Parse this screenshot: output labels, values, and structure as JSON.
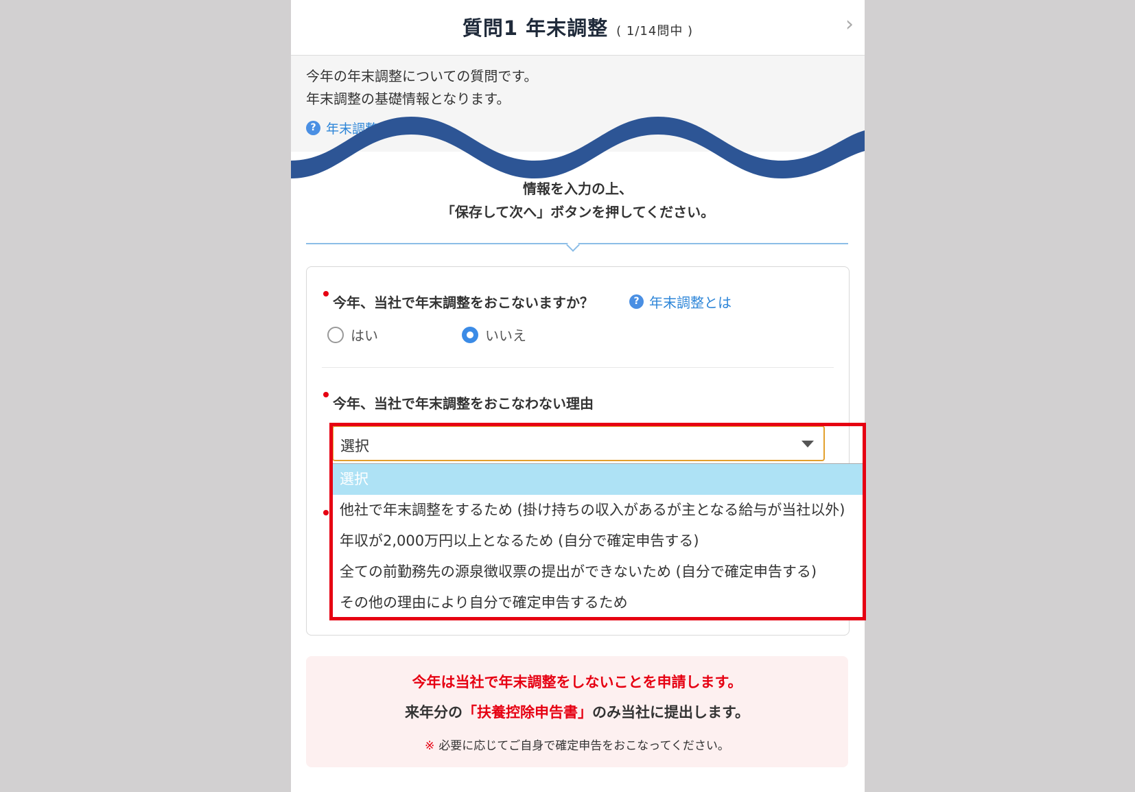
{
  "header": {
    "title": "質問1 年末調整",
    "count": "( 1/14問中 )",
    "next_icon": "chevron-right-icon"
  },
  "intro": {
    "line1": "今年の年末調整についての質問です。",
    "line2": "年末調整の基礎情報となります。",
    "link": "年末調整とは"
  },
  "instruction": {
    "line1": "情報を入力の上、",
    "line2": "「保存して次へ」ボタンを押してください。"
  },
  "question1": {
    "label": "今年、当社で年末調整をおこないますか？",
    "help_link": "年末調整とは",
    "options": [
      {
        "label": "はい",
        "checked": false
      },
      {
        "label": "いいえ",
        "checked": true
      }
    ]
  },
  "question2": {
    "label": "今年、当社で年末調整をおこなわない理由",
    "select_value": "選択",
    "dropdown_options": [
      {
        "label": "選択",
        "selected": true
      },
      {
        "label": "他社で年末調整をするため (掛け持ちの収入があるが主となる給与が当社以外)",
        "selected": false
      },
      {
        "label": "年収が2,000万円以上となるため (自分で確定申告する)",
        "selected": false
      },
      {
        "label": "全ての前勤務先の源泉徴収票の提出ができないため (自分で確定申告する)",
        "selected": false
      },
      {
        "label": "その他の理由により自分で確定申告するため",
        "selected": false
      }
    ]
  },
  "notice": {
    "line1": "今年は当社で年末調整をしないことを申請します。",
    "line2_pre": "来年分の",
    "line2_highlight": "「扶養控除申告書」",
    "line2_post": "のみ当社に提出します。",
    "line3_mark": "※",
    "line3": "必要に応じてご自身で確定申告をおこなってください。"
  },
  "colors": {
    "accent_blue": "#2e86d8",
    "wave_navy": "#2d5595",
    "required_red": "#e60012",
    "select_border": "#e39f2c",
    "dropdown_selected": "#aee2f5"
  }
}
